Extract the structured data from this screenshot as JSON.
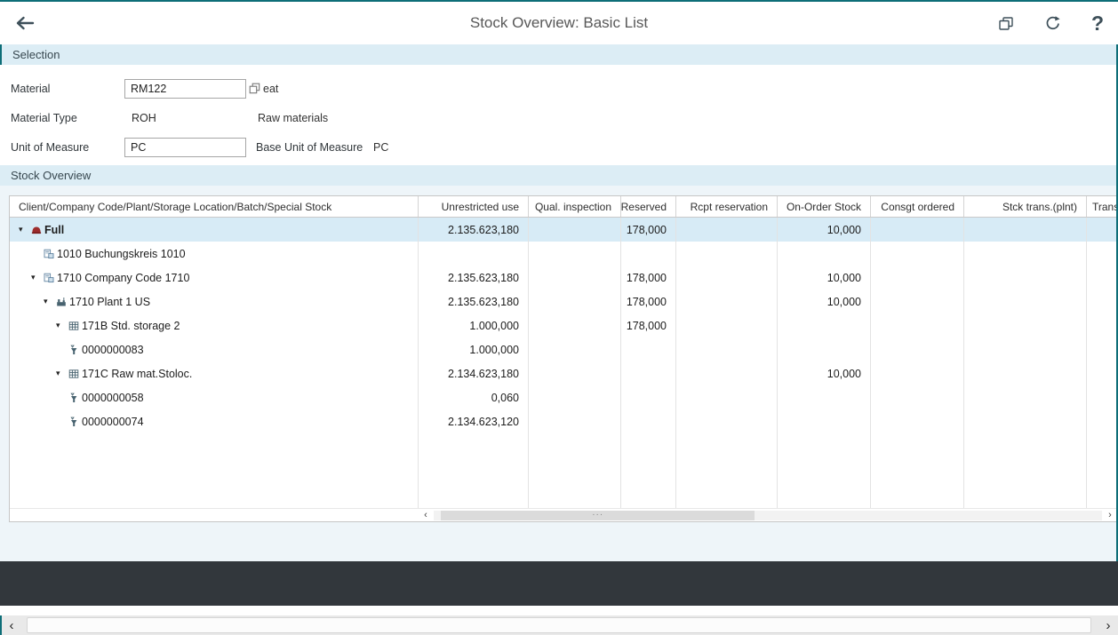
{
  "app": {
    "title": "Stock Overview: Basic List",
    "toolbar": {
      "help": "?"
    }
  },
  "theme": {
    "accent_teal": "#0e6e78",
    "band_blue": "#dcedf5",
    "content_light": "#eef5f9",
    "selected_row": "#d7ebf6",
    "footer_dark": "#32373c"
  },
  "selection": {
    "title": "Selection",
    "material": {
      "label": "Material",
      "value": "RM122",
      "description": "eat"
    },
    "material_type": {
      "label": "Material Type",
      "value": "ROH",
      "description": "Raw materials"
    },
    "unit_of_measure": {
      "label": "Unit of Measure",
      "value": "PC"
    },
    "base_unit": {
      "label": "Base Unit of Measure",
      "value": "PC"
    }
  },
  "stock": {
    "title": "Stock Overview",
    "columns": [
      "Client/Company Code/Plant/Storage Location/Batch/Special Stock",
      "Unrestricted use",
      "Qual. inspection",
      "Reserved",
      "Rcpt reservation",
      "On-Order Stock",
      "Consgt ordered",
      "Stck trans.(plnt)",
      "Trans"
    ],
    "rows": [
      {
        "label": "Full",
        "level": 0,
        "arrow": "open",
        "icon": "client-icon",
        "selected": true,
        "values": [
          "2.135.623,180",
          "",
          "178,000",
          "",
          "10,000",
          "",
          "",
          ""
        ]
      },
      {
        "label": "1010 Buchungskreis 1010",
        "level": 1,
        "arrow": "space",
        "icon": "company-code-icon",
        "values": [
          "",
          "",
          "",
          "",
          "",
          "",
          "",
          ""
        ]
      },
      {
        "label": "1710 Company Code 1710",
        "level": 1,
        "arrow": "open",
        "icon": "company-code-icon",
        "values": [
          "2.135.623,180",
          "",
          "178,000",
          "",
          "10,000",
          "",
          "",
          ""
        ]
      },
      {
        "label": "1710 Plant 1 US",
        "level": 2,
        "arrow": "open",
        "icon": "plant-icon",
        "values": [
          "2.135.623,180",
          "",
          "178,000",
          "",
          "10,000",
          "",
          "",
          ""
        ]
      },
      {
        "label": "171B Std. storage 2",
        "level": 3,
        "arrow": "open",
        "icon": "storage-location-icon",
        "values": [
          "1.000,000",
          "",
          "178,000",
          "",
          "",
          "",
          "",
          ""
        ]
      },
      {
        "label": "0000000083",
        "level": 4,
        "arrow": "none",
        "icon": "batch-icon",
        "values": [
          "1.000,000",
          "",
          "",
          "",
          "",
          "",
          "",
          ""
        ]
      },
      {
        "label": "171C Raw mat.Stoloc.",
        "level": 3,
        "arrow": "open",
        "icon": "storage-location-icon",
        "values": [
          "2.134.623,180",
          "",
          "",
          "",
          "10,000",
          "",
          "",
          ""
        ]
      },
      {
        "label": "0000000058",
        "level": 4,
        "arrow": "none",
        "icon": "batch-icon",
        "values": [
          "0,060",
          "",
          "",
          "",
          "",
          "",
          "",
          ""
        ]
      },
      {
        "label": "0000000074",
        "level": 4,
        "arrow": "none",
        "icon": "batch-icon",
        "values": [
          "2.134.623,120",
          "",
          "",
          "",
          "",
          "",
          "",
          ""
        ]
      }
    ]
  },
  "scrollbars": {
    "left_arrow": "‹",
    "right_arrow": "›",
    "grip": "···"
  }
}
